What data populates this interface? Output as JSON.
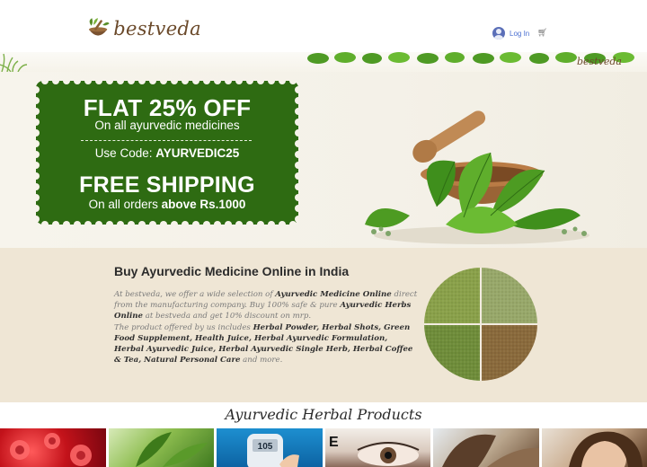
{
  "header": {
    "brand": "bestveda",
    "login_label": "Log In",
    "cart_icon": "cart-icon"
  },
  "strip": {
    "brand": "bestveda"
  },
  "promo": {
    "title": "FLAT 25% OFF",
    "subtitle": "On all ayurvedic medicines",
    "code_prefix": "Use Code:",
    "code": "AYURVEDIC25",
    "shipping_title": "FREE SHIPPING",
    "orders_prefix": "On all orders",
    "orders_threshold": "above Rs.1000",
    "color": "#2e6b12"
  },
  "about": {
    "title": "Buy Ayurvedic Medicine Online in India",
    "p1_a": "At bestveda, we offer a wide selection of ",
    "p1_b": "Ayurvedic Medicine Online",
    "p1_c": " direct from the manufacturing company. Buy 100% safe & pure ",
    "p1_d": "Ayurvedic Herbs Online",
    "p1_e": " at bestveda and get 10% discount on mrp.",
    "p2_a": "The product offered by us includes ",
    "p2_b": "Herbal Powder, Herbal Shots, Green Food Supplement, Health Juice, Herbal Ayurvedic Formulation, Herbal Ayurvedic Juice, Herbal Ayurvedic Single Herb, Herbal Coffee & Tea, Natural Personal Care",
    "p2_c": " and more."
  },
  "products": {
    "title": "Ayurvedic Herbal Products",
    "tiles": [
      {
        "image": "blood-cells"
      },
      {
        "image": "green-leaves"
      },
      {
        "image": "glucose-meter",
        "text": "105"
      },
      {
        "image": "eye-chart",
        "text": "E"
      },
      {
        "image": "hair-woman"
      },
      {
        "image": "woman-face"
      }
    ]
  }
}
